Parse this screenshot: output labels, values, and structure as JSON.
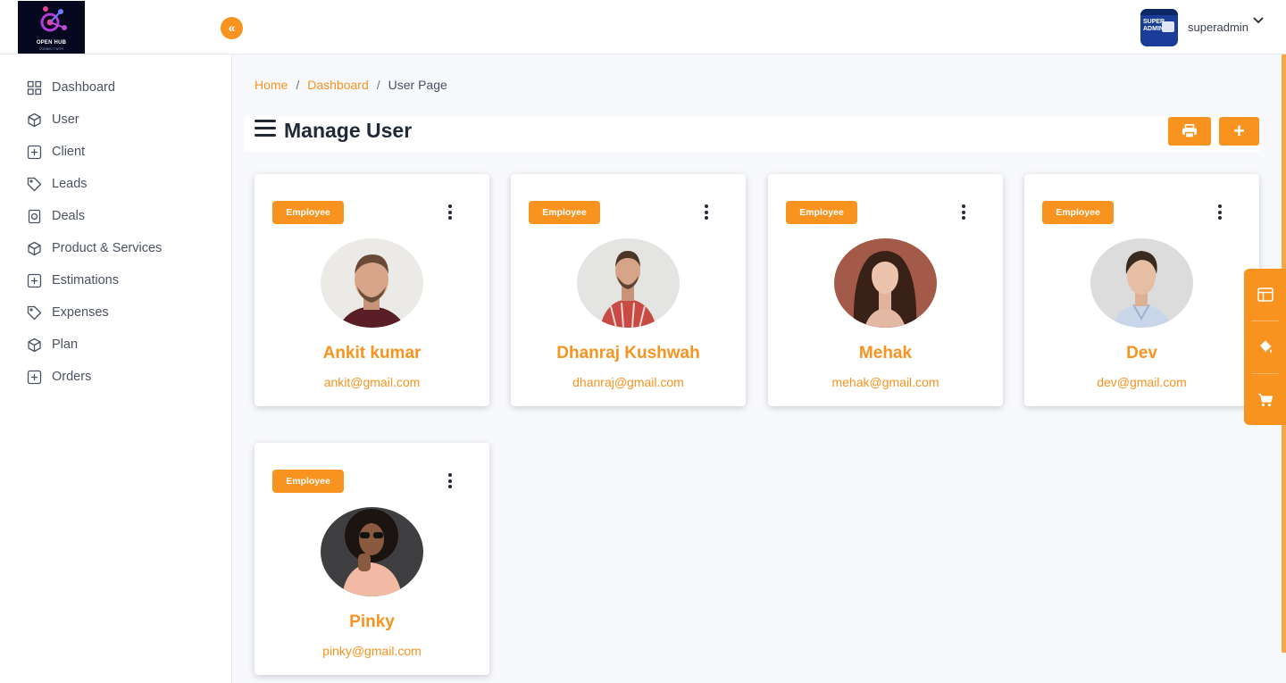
{
  "app": {
    "logo_text": "OPEN HUB",
    "logo_subtext": "CONNECT WITH"
  },
  "topbar": {
    "collapse_icon": "double-chevron-left-icon",
    "avatar_text": "SUPER ADMIN",
    "username": "superadmin"
  },
  "sidebar": {
    "items": [
      {
        "label": "Dashboard",
        "icon": "grid-icon"
      },
      {
        "label": "User",
        "icon": "cube-icon"
      },
      {
        "label": "Client",
        "icon": "plus-square-icon"
      },
      {
        "label": "Leads",
        "icon": "tag-icon"
      },
      {
        "label": "Deals",
        "icon": "safe-icon"
      },
      {
        "label": "Product & Services",
        "icon": "cube-icon"
      },
      {
        "label": "Estimations",
        "icon": "plus-square-icon"
      },
      {
        "label": "Expenses",
        "icon": "tag-icon"
      },
      {
        "label": "Plan",
        "icon": "cube-icon"
      },
      {
        "label": "Orders",
        "icon": "plus-square-icon"
      }
    ]
  },
  "breadcrumb": {
    "home": "Home",
    "dashboard": "Dashboard",
    "current": "User Page",
    "separator": "/"
  },
  "page": {
    "title": "Manage User",
    "add_label": "+"
  },
  "users": [
    {
      "role": "Employee",
      "name": "Ankit kumar",
      "email": "ankit@gmail.com"
    },
    {
      "role": "Employee",
      "name": "Dhanraj Kushwah",
      "email": "dhanraj@gmail.com"
    },
    {
      "role": "Employee",
      "name": "Mehak",
      "email": "mehak@gmail.com"
    },
    {
      "role": "Employee",
      "name": "Dev",
      "email": "dev@gmail.com"
    },
    {
      "role": "Employee",
      "name": "Pinky",
      "email": "pinky@gmail.com"
    }
  ],
  "colors": {
    "accent": "#f7931e",
    "text_dark": "#1f2937",
    "background": "#f8f9fc"
  }
}
